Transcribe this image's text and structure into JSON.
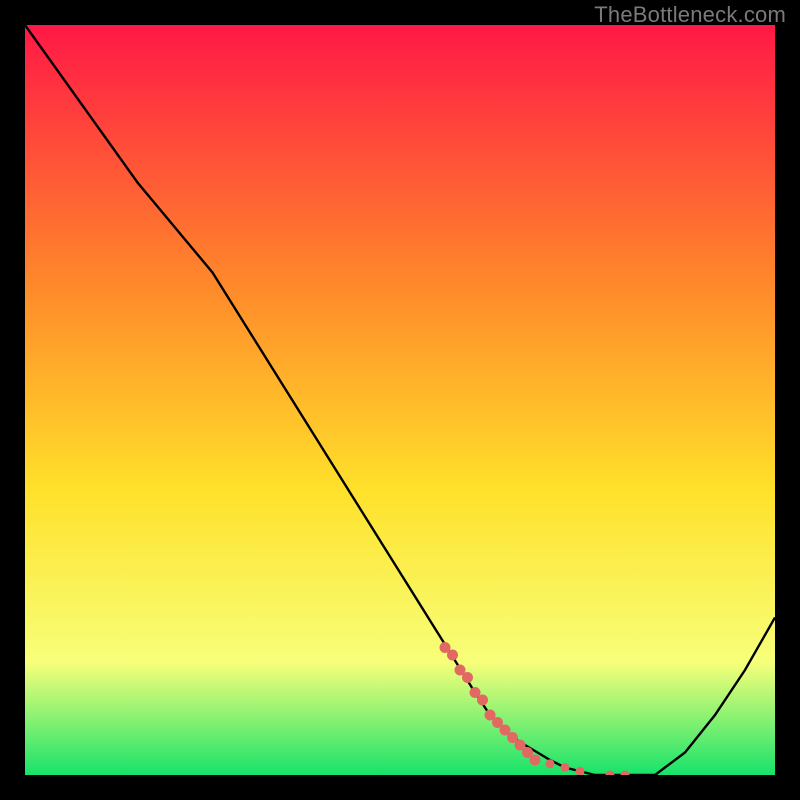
{
  "watermark": "TheBottleneck.com",
  "colors": {
    "bg": "#000000",
    "watermark": "#7a7a7a",
    "gradient_top": "#ff1846",
    "gradient_mid1": "#ff8a2a",
    "gradient_mid2": "#ffe12a",
    "gradient_mid3": "#f7ff7a",
    "gradient_bottom": "#17e36a",
    "line": "#000000",
    "marker": "#e06a62"
  },
  "chart_data": {
    "type": "line",
    "title": "",
    "xlabel": "",
    "ylabel": "",
    "xlim": [
      0,
      100
    ],
    "ylim": [
      0,
      100
    ],
    "series": [
      {
        "name": "bottleneck-curve",
        "x": [
          0,
          5,
          10,
          15,
          20,
          25,
          30,
          35,
          40,
          45,
          50,
          55,
          60,
          62,
          65,
          70,
          72,
          76,
          80,
          84,
          88,
          92,
          96,
          100
        ],
        "y": [
          100,
          93,
          86,
          79,
          73,
          67,
          59,
          51,
          43,
          35,
          27,
          19,
          11,
          8,
          5,
          2,
          1,
          0,
          0,
          0,
          3,
          8,
          14,
          21
        ]
      }
    ],
    "markers": {
      "name": "highlight-dots",
      "x": [
        56,
        57,
        58,
        59,
        60,
        61,
        62,
        63,
        64,
        65,
        66,
        67,
        68,
        70,
        72,
        74,
        78,
        80
      ],
      "y": [
        17,
        16,
        14,
        13,
        11,
        10,
        8,
        7,
        6,
        5,
        4,
        3,
        2,
        1.5,
        1,
        0.5,
        0,
        0
      ]
    }
  }
}
